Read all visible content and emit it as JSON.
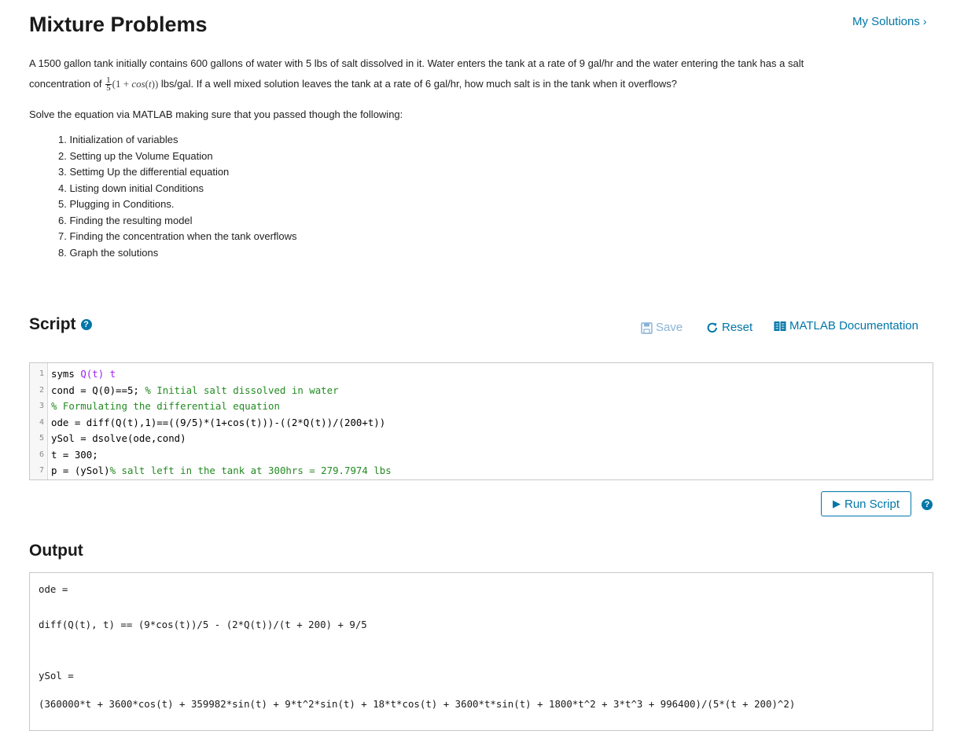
{
  "header": {
    "title": "Mixture Problems",
    "my_solutions": "My Solutions",
    "chevron": "›"
  },
  "problem": {
    "line1": "A 1500 gallon tank initially contains 600 gallons of water with 5 lbs of salt dissolved in it. Water enters the tank at a rate of 9 gal/hr and the water entering the tank has a salt",
    "concentration_prefix": "concentration of",
    "frac_num": "1",
    "frac_den": "5",
    "math_expr_a": "(1 + ",
    "math_expr_fn": "cos",
    "math_expr_b": "(",
    "math_expr_var": "t",
    "math_expr_c": "))",
    "line2_rest": "lbs/gal. If a well mixed solution leaves the tank at a rate of 6 gal/hr, how much salt is in the tank when it overflows?"
  },
  "instructions": {
    "intro": "Solve the equation via MATLAB making sure that you passed though the following:",
    "steps": [
      "1. Initialization of variables",
      "2. Setting up the Volume Equation",
      "3. Settimg Up the differential equation",
      "4. Listing down initial Conditions",
      "5. Plugging in Conditions.",
      "6. Finding the resulting model",
      "7. Finding the concentration when the tank overflows",
      "8. Graph the solutions"
    ]
  },
  "script": {
    "heading": "Script",
    "help_glyph": "?",
    "save_label": "Save",
    "reset_label": "Reset",
    "doc_label": "MATLAB Documentation",
    "lines": [
      {
        "n": "1",
        "parts": [
          {
            "t": "syms ",
            "c": ""
          },
          {
            "t": "Q(t) t",
            "c": "kw"
          }
        ]
      },
      {
        "n": "2",
        "parts": [
          {
            "t": "cond = Q(0)==5; ",
            "c": ""
          },
          {
            "t": "% Initial salt dissolved in water",
            "c": "cm"
          }
        ]
      },
      {
        "n": "3",
        "parts": [
          {
            "t": "% Formulating the differential equation",
            "c": "cm"
          }
        ]
      },
      {
        "n": "4",
        "parts": [
          {
            "t": "ode = diff(Q(t),1)==((9/5)*(1+cos(t)))-((2*Q(t))/(200+t))",
            "c": ""
          }
        ]
      },
      {
        "n": "5",
        "parts": [
          {
            "t": "ySol = dsolve(ode,cond)",
            "c": ""
          }
        ]
      },
      {
        "n": "6",
        "parts": [
          {
            "t": "t = 300;",
            "c": ""
          }
        ]
      },
      {
        "n": "7",
        "parts": [
          {
            "t": "p = (ySol)",
            "c": ""
          },
          {
            "t": "% salt left in the tank at 300hrs = 279.7974 lbs",
            "c": "cm"
          }
        ]
      }
    ],
    "run_label": "Run Script",
    "run_glyph": "▶"
  },
  "output": {
    "heading": "Output",
    "lines": [
      "ode =",
      "diff(Q(t), t) == (9*cos(t))/5 - (2*Q(t))/(t + 200) + 9/5",
      "ySol =",
      "(360000*t + 3600*cos(t) + 359982*sin(t) + 9*t^2*sin(t) + 18*t*cos(t) + 3600*t*sin(t) + 1800*t^2 + 3*t^3 + 996400)/(5*(t + 200)^2)"
    ]
  },
  "colors": {
    "accent": "#0076a8",
    "comment": "#228b22",
    "keyword": "#a020f0"
  }
}
